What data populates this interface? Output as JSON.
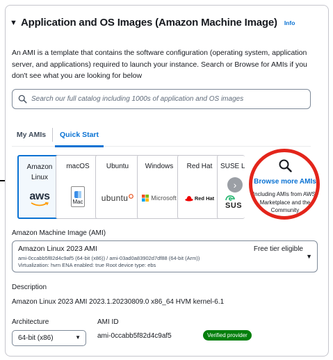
{
  "section": {
    "title": "Application and OS Images (Amazon Machine Image)",
    "info_label": "Info",
    "description": "An AMI is a template that contains the software configuration (operating system, application server, and applications) required to launch your instance. Search or Browse for AMIs if you don't see what you are looking for below"
  },
  "search": {
    "placeholder": "Search our full catalog including 1000s of application and OS images",
    "icon": "search-icon"
  },
  "tabs": [
    {
      "label": "My AMIs",
      "active": false
    },
    {
      "label": "Quick Start",
      "active": true
    }
  ],
  "quick_start_cards": [
    {
      "name": "Amazon Linux",
      "logo_text": "aws",
      "selected": true
    },
    {
      "name": "macOS",
      "logo_text": "Mac",
      "selected": false
    },
    {
      "name": "Ubuntu",
      "logo_text": "ubuntu",
      "selected": false
    },
    {
      "name": "Windows",
      "logo_text": "Microsoft",
      "selected": false
    },
    {
      "name": "Red Hat",
      "logo_text": "Red Hat",
      "selected": false
    },
    {
      "name": "SUSE Li",
      "logo_text": "SUS",
      "selected": false
    }
  ],
  "browse": {
    "label": "Browse more AMIs",
    "sublabel": "Including AMIs from AWS, Marketplace and the Community"
  },
  "ami_select": {
    "field_label": "Amazon Machine Image (AMI)",
    "name": "Amazon Linux 2023 AMI",
    "ids": "ami-0ccabb5f82d4c9af5 (64-bit (x86)) / ami-03ad0a83902d7df88 (64-bit (Arm))",
    "meta": "Virtualization: hvm    ENA enabled: true    Root device type: ebs",
    "free_tier": "Free tier eligible"
  },
  "description_field": {
    "label": "Description",
    "value": "Amazon Linux 2023 AMI 2023.1.20230809.0 x86_64 HVM kernel-6.1"
  },
  "architecture": {
    "label": "Architecture",
    "value": "64-bit (x86)"
  },
  "ami_id": {
    "label": "AMI ID",
    "value": "ami-0ccabb5f82d4c9af5",
    "badge": "Verified provider"
  },
  "colors": {
    "link": "#0972d3",
    "highlight_ring": "#e3251b",
    "verified_badge": "#037f0c"
  }
}
